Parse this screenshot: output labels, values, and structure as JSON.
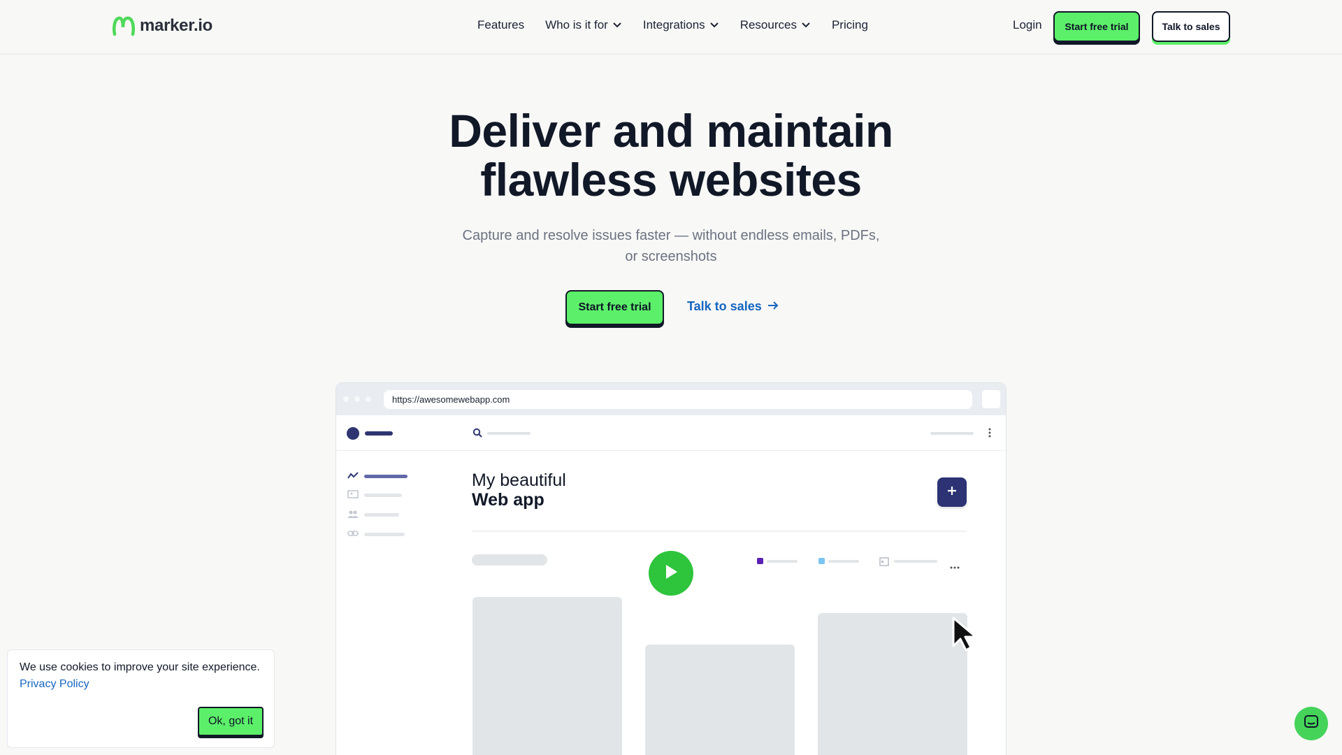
{
  "brand": {
    "name": "marker.io",
    "logo_color": "#4ed95a",
    "logo_icon": "marker-logo-icon"
  },
  "nav": {
    "items": [
      {
        "label": "Features",
        "dropdown": false
      },
      {
        "label": "Who is it for",
        "dropdown": true
      },
      {
        "label": "Integrations",
        "dropdown": true
      },
      {
        "label": "Resources",
        "dropdown": true
      },
      {
        "label": "Pricing",
        "dropdown": false
      }
    ],
    "login": "Login",
    "trial": "Start free trial",
    "sales": "Talk to sales"
  },
  "hero": {
    "title_line1": "Deliver and maintain",
    "title_line2": "flawless websites",
    "subtitle_line1": "Capture and resolve issues faster — without endless emails, PDFs,",
    "subtitle_line2": "or screenshots",
    "cta_primary": "Start free trial",
    "cta_secondary": "Talk to sales"
  },
  "mock": {
    "url": "https://awesomewebapp.com",
    "title_line1": "My beautiful",
    "title_line2": "Web app",
    "legend_colors": [
      "#5b21b6",
      "#7cc4f0"
    ],
    "accent": "#2c3273"
  },
  "cookie": {
    "text": "We use cookies to improve your site experience.",
    "link": "Privacy Policy",
    "button": "Ok, got it"
  },
  "colors": {
    "green": "#5cf06a",
    "link": "#1565c0",
    "text": "#111827",
    "muted": "#6b7280"
  }
}
